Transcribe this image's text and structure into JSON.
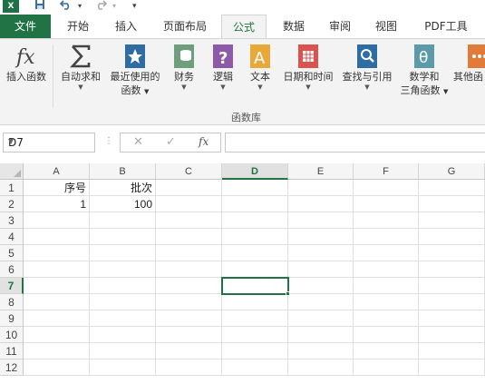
{
  "quick_access": {
    "app_icon": "X",
    "save_icon": "save-icon",
    "undo_icon": "undo-icon",
    "redo_icon": "redo-icon"
  },
  "tabs": [
    {
      "label": "文件"
    },
    {
      "label": "开始"
    },
    {
      "label": "插入"
    },
    {
      "label": "页面布局"
    },
    {
      "label": "公式"
    },
    {
      "label": "数据"
    },
    {
      "label": "审阅"
    },
    {
      "label": "视图"
    },
    {
      "label": "PDF工具"
    }
  ],
  "ribbon": {
    "buttons": [
      {
        "label": "插入函数",
        "label2": ""
      },
      {
        "label": "自动求和",
        "label2": ""
      },
      {
        "label": "最近使用的",
        "label2": "函数"
      },
      {
        "label": "财务",
        "label2": ""
      },
      {
        "label": "逻辑",
        "label2": ""
      },
      {
        "label": "文本",
        "label2": ""
      },
      {
        "label": "日期和时间",
        "label2": ""
      },
      {
        "label": "查找与引用",
        "label2": ""
      },
      {
        "label": "数学和",
        "label2": "三角函数"
      },
      {
        "label": "其他函",
        "label2": ""
      }
    ],
    "group_label": "函数库"
  },
  "formula_bar": {
    "name_box": "D7",
    "fx": "fx",
    "cancel": "✕",
    "confirm": "✓",
    "value": ""
  },
  "grid": {
    "columns": [
      "A",
      "B",
      "C",
      "D",
      "E",
      "F",
      "G"
    ],
    "selected_column": "D",
    "rows": [
      "1",
      "2",
      "3",
      "4",
      "5",
      "6",
      "7",
      "8",
      "9",
      "10",
      "11",
      "12"
    ],
    "selected_row": "7",
    "cells": {
      "A1": "序号",
      "B1": "批次",
      "A2": "1",
      "B2": "100"
    },
    "active_cell": "D7"
  },
  "colors": {
    "accent": "#217346",
    "excel_icon": "#1e7145"
  }
}
